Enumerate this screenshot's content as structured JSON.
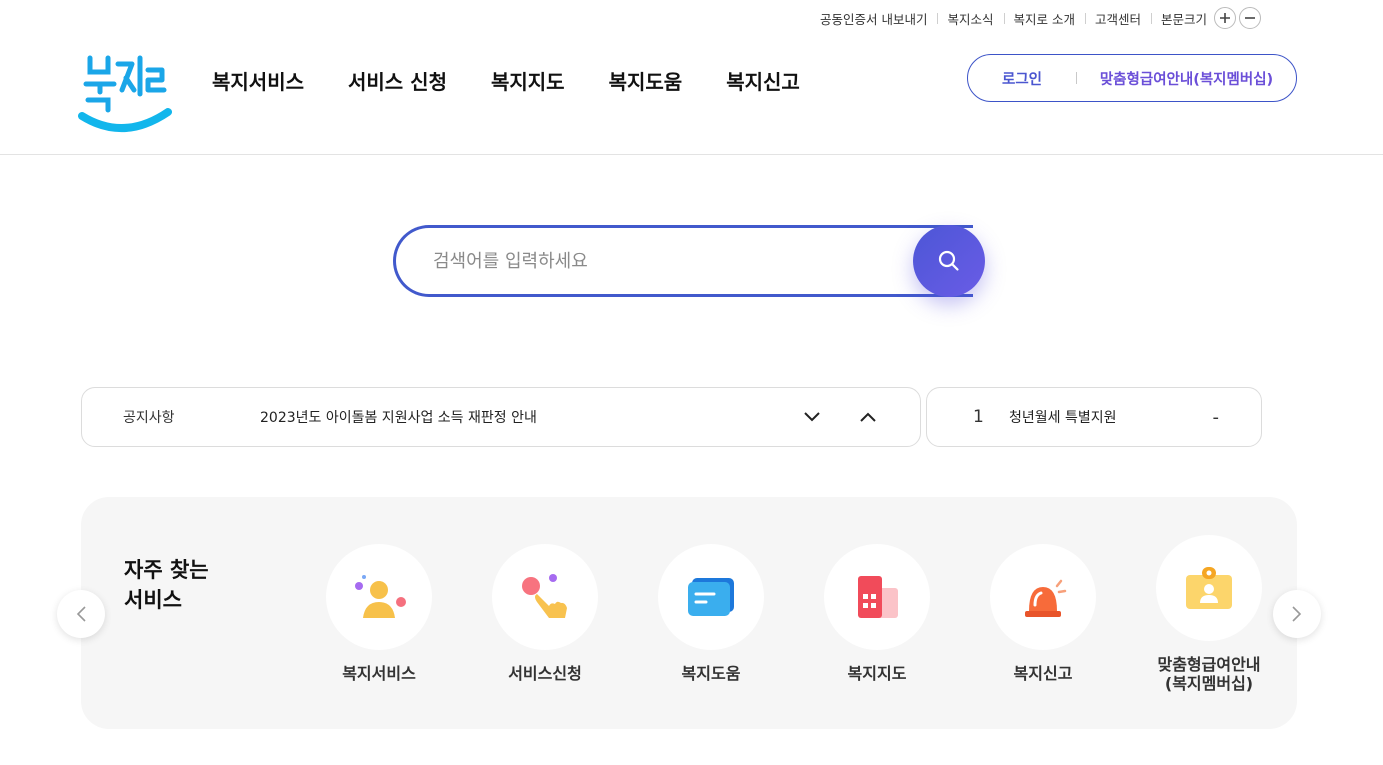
{
  "utility": {
    "cert_export": "공동인증서 내보내기",
    "news": "복지소식",
    "about": "복지로 소개",
    "support": "고객센터",
    "font_size_label": "본문크기"
  },
  "logo": {
    "alt": "복지로"
  },
  "gnb": {
    "items": [
      "복지서비스",
      "서비스 신청",
      "복지지도",
      "복지도움",
      "복지신고"
    ]
  },
  "member": {
    "login": "로그인",
    "custom_info": "맞춤형급여안내(복지멤버십)"
  },
  "search": {
    "placeholder": "검색어를 입력하세요"
  },
  "notice": {
    "label": "공지사항",
    "text": "2023년도 아이돌봄 지원사업 소득 재판정 안내"
  },
  "ranking": {
    "number": "1",
    "text": "청년월세 특별지원",
    "change": "-"
  },
  "frequent": {
    "title_line1": "자주 찾는",
    "title_line2": "서비스",
    "items": [
      {
        "label": "복지서비스",
        "icon": "person-icon"
      },
      {
        "label": "서비스신청",
        "icon": "hand-tap-icon"
      },
      {
        "label": "복지도움",
        "icon": "chat-bubble-icon"
      },
      {
        "label": "복지지도",
        "icon": "building-icon"
      },
      {
        "label": "복지신고",
        "icon": "siren-icon"
      },
      {
        "label_line1": "맞춤형급여안내",
        "label_line2": "(복지멤버십)",
        "icon": "id-badge-icon"
      }
    ]
  },
  "colors": {
    "brand_blue": "#4159cc",
    "brand_purple": "#6a5ce6"
  }
}
